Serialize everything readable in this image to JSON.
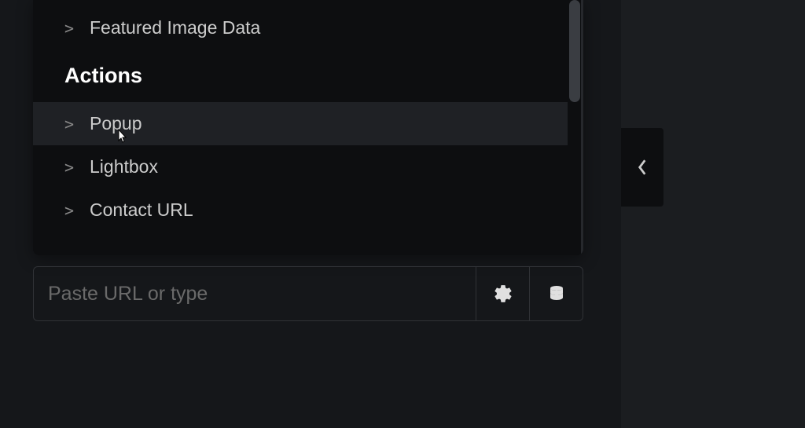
{
  "list": {
    "item_featured": "Featured Image Data",
    "section_actions": "Actions",
    "item_popup": "Popup",
    "item_lightbox": "Lightbox",
    "item_contact_url": "Contact URL"
  },
  "input": {
    "placeholder": "Paste URL or type"
  },
  "icons": {
    "gear": "gear-icon",
    "database": "database-icon",
    "collapse": "chevron-left-icon"
  }
}
